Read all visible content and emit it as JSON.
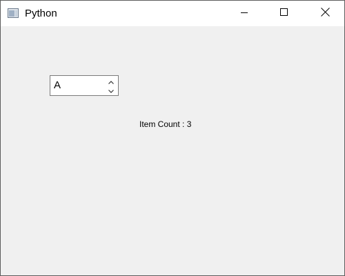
{
  "window": {
    "title": "Python",
    "icon": "python-window-icon",
    "controls": {
      "minimize_icon": "minimize-icon",
      "maximize_icon": "maximize-icon",
      "close_icon": "close-icon"
    }
  },
  "spinbox": {
    "value": "A",
    "up_icon": "chevron-up-icon",
    "down_icon": "chevron-down-icon"
  },
  "label": {
    "item_count": "Item Count : 3"
  },
  "colors": {
    "window_bg": "#f0f0f0",
    "titlebar_bg": "#ffffff",
    "border": "#7a7a7a"
  }
}
